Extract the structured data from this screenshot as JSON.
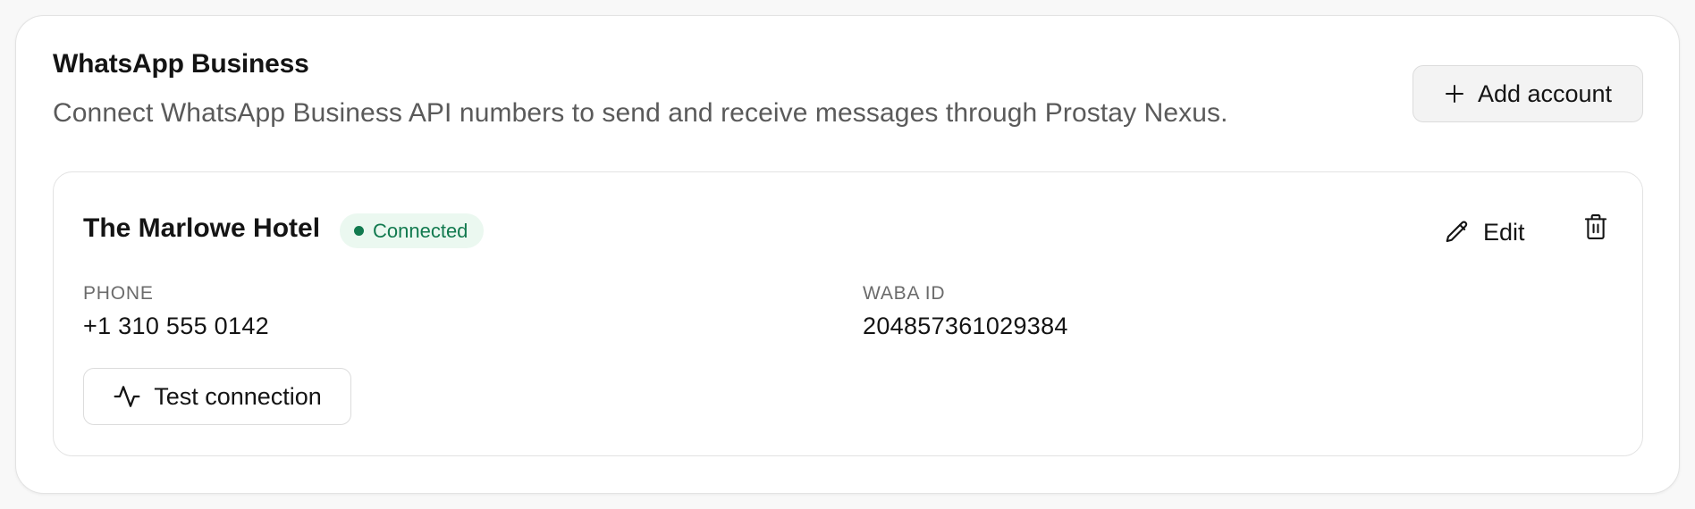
{
  "section": {
    "title": "WhatsApp Business",
    "description": "Connect WhatsApp Business API numbers to send and receive messages through Prostay Nexus.",
    "add_button_label": "Add account"
  },
  "account": {
    "name": "The Marlowe Hotel",
    "status": "Connected",
    "edit_label": "Edit",
    "fields": [
      {
        "label": "PHONE",
        "value": "+1 310 555 0142"
      },
      {
        "label": "WABA ID",
        "value": "204857361029384"
      }
    ],
    "test_button_label": "Test connection"
  },
  "icons": {
    "add": "plus-icon",
    "edit": "pencil-icon",
    "delete": "trash-icon",
    "test": "activity-icon"
  },
  "colors": {
    "status_text": "#127a4f",
    "status_bg": "#ebf8f0",
    "button_bg": "#f3f3f3"
  }
}
